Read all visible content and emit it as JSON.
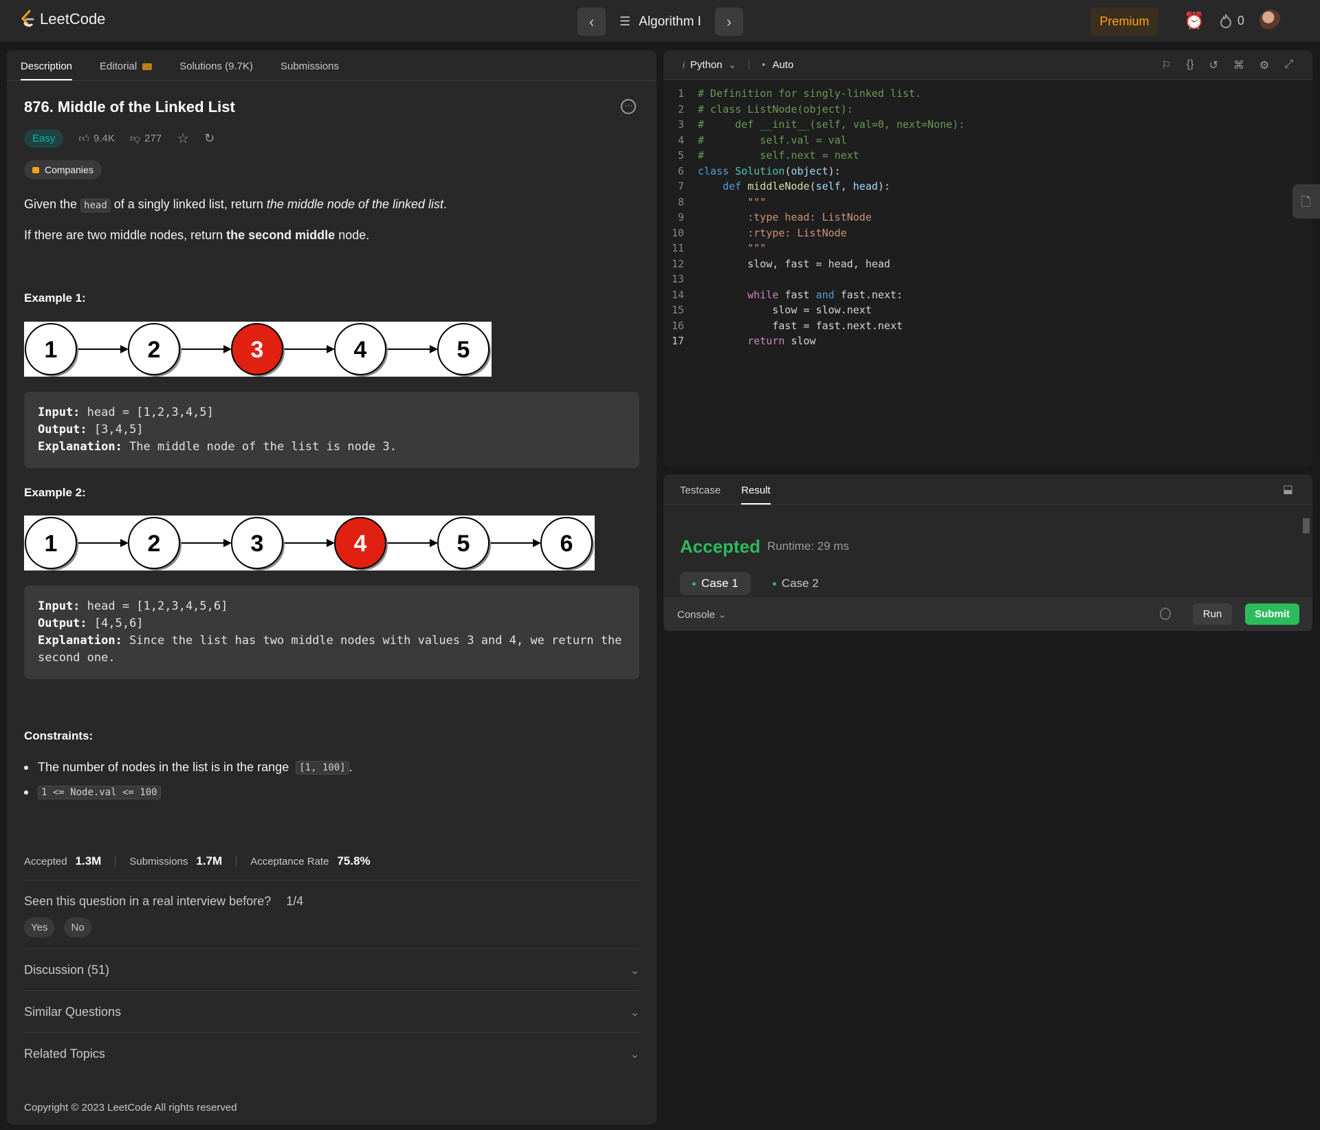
{
  "topnav": {
    "logo": "LeetCode",
    "list_title": "Algorithm I",
    "premium": "Premium",
    "streak": "0"
  },
  "tabs": [
    {
      "label": "Description"
    },
    {
      "label": "Editorial"
    },
    {
      "label": "Solutions (9.7K)"
    },
    {
      "label": "Submissions"
    }
  ],
  "problem": {
    "title": "876. Middle of the Linked List",
    "difficulty": "Easy",
    "likes": "9.4K",
    "dislikes": "277",
    "companies": "Companies",
    "p1_a": "Given the ",
    "p1_code": "head",
    "p1_b": " of a singly linked list, return ",
    "p1_em": "the middle node of the linked list",
    "p1_c": ".",
    "p2_a": "If there are two middle nodes, return ",
    "p2_b": "the second middle",
    "p2_c": " node."
  },
  "examples": [
    {
      "heading": "Example 1:",
      "nodes": [
        "1",
        "2",
        "3",
        "4",
        "5"
      ],
      "highlight": 2,
      "input_label": "Input:",
      "input": " head = [1,2,3,4,5]",
      "output_label": "Output:",
      "output": " [3,4,5]",
      "expl_label": "Explanation:",
      "explanation": " The middle node of the list is node 3."
    },
    {
      "heading": "Example 2:",
      "nodes": [
        "1",
        "2",
        "3",
        "4",
        "5",
        "6"
      ],
      "highlight": 3,
      "input_label": "Input:",
      "input": " head = [1,2,3,4,5,6]",
      "output_label": "Output:",
      "output": " [4,5,6]",
      "expl_label": "Explanation:",
      "explanation": " Since the list has two middle nodes with values 3 and 4, we return the second one."
    }
  ],
  "constraints": {
    "heading": "Constraints:",
    "c1_a": "The number of nodes in the list is in the range ",
    "c1_code": "[1, 100]",
    "c1_b": ".",
    "c2_code": "1 <= Node.val <= 100"
  },
  "stats": {
    "accepted_label": "Accepted",
    "accepted": "1.3M",
    "submissions_label": "Submissions",
    "submissions": "1.7M",
    "rate_label": "Acceptance Rate",
    "rate": "75.8%"
  },
  "seen": {
    "question": "Seen this question in a real interview before?",
    "count": "1/4",
    "yes": "Yes",
    "no": "No"
  },
  "accordions": [
    {
      "label": "Discussion (51)"
    },
    {
      "label": "Similar Questions"
    },
    {
      "label": "Related Topics"
    }
  ],
  "copyright": "Copyright © 2023 LeetCode All rights reserved",
  "editor": {
    "language": "Python",
    "mode": "Auto",
    "code": [
      [
        [
          "c-cm",
          "# Definition for singly-linked list."
        ]
      ],
      [
        [
          "c-cm",
          "# class ListNode(object):"
        ]
      ],
      [
        [
          "c-cm",
          "#     def __init__(self, val=0, next=None):"
        ]
      ],
      [
        [
          "c-cm",
          "#         self.val = val"
        ]
      ],
      [
        [
          "c-cm",
          "#         self.next = next"
        ]
      ],
      [
        [
          "c-kw",
          "class "
        ],
        [
          "c-cls",
          "Solution"
        ],
        [
          "c-id",
          "("
        ],
        [
          "c-self",
          "object"
        ],
        [
          "c-id",
          "):"
        ]
      ],
      [
        [
          "c-id",
          "    "
        ],
        [
          "c-kw",
          "def "
        ],
        [
          "c-fn",
          "middleNode"
        ],
        [
          "c-id",
          "("
        ],
        [
          "c-self",
          "self"
        ],
        [
          "c-id",
          ", "
        ],
        [
          "c-self",
          "head"
        ],
        [
          "c-id",
          "):"
        ]
      ],
      [
        [
          "c-id",
          "        "
        ],
        [
          "c-str",
          "\"\"\""
        ]
      ],
      [
        [
          "c-id",
          "        "
        ],
        [
          "c-str",
          ":type head: ListNode"
        ]
      ],
      [
        [
          "c-id",
          "        "
        ],
        [
          "c-str",
          ":rtype: ListNode"
        ]
      ],
      [
        [
          "c-id",
          "        "
        ],
        [
          "c-str",
          "\"\"\""
        ]
      ],
      [
        [
          "c-id",
          "        slow, fast = head, head"
        ]
      ],
      [
        [
          "c-id",
          ""
        ]
      ],
      [
        [
          "c-id",
          "        "
        ],
        [
          "c-kw2",
          "while "
        ],
        [
          "c-id",
          "fast "
        ],
        [
          "c-kw",
          "and "
        ],
        [
          "c-id",
          "fast.next:"
        ]
      ],
      [
        [
          "c-id",
          "            slow = slow.next"
        ]
      ],
      [
        [
          "c-id",
          "            fast = fast.next.next"
        ]
      ],
      [
        [
          "c-id",
          "        "
        ],
        [
          "c-kw2",
          "return "
        ],
        [
          "c-id",
          "slow"
        ]
      ]
    ]
  },
  "result": {
    "tab_testcase": "Testcase",
    "tab_result": "Result",
    "status": "Accepted",
    "runtime": "Runtime: 29 ms",
    "case1": "Case 1",
    "case2": "Case 2",
    "console": "Console",
    "run": "Run",
    "submit": "Submit"
  }
}
